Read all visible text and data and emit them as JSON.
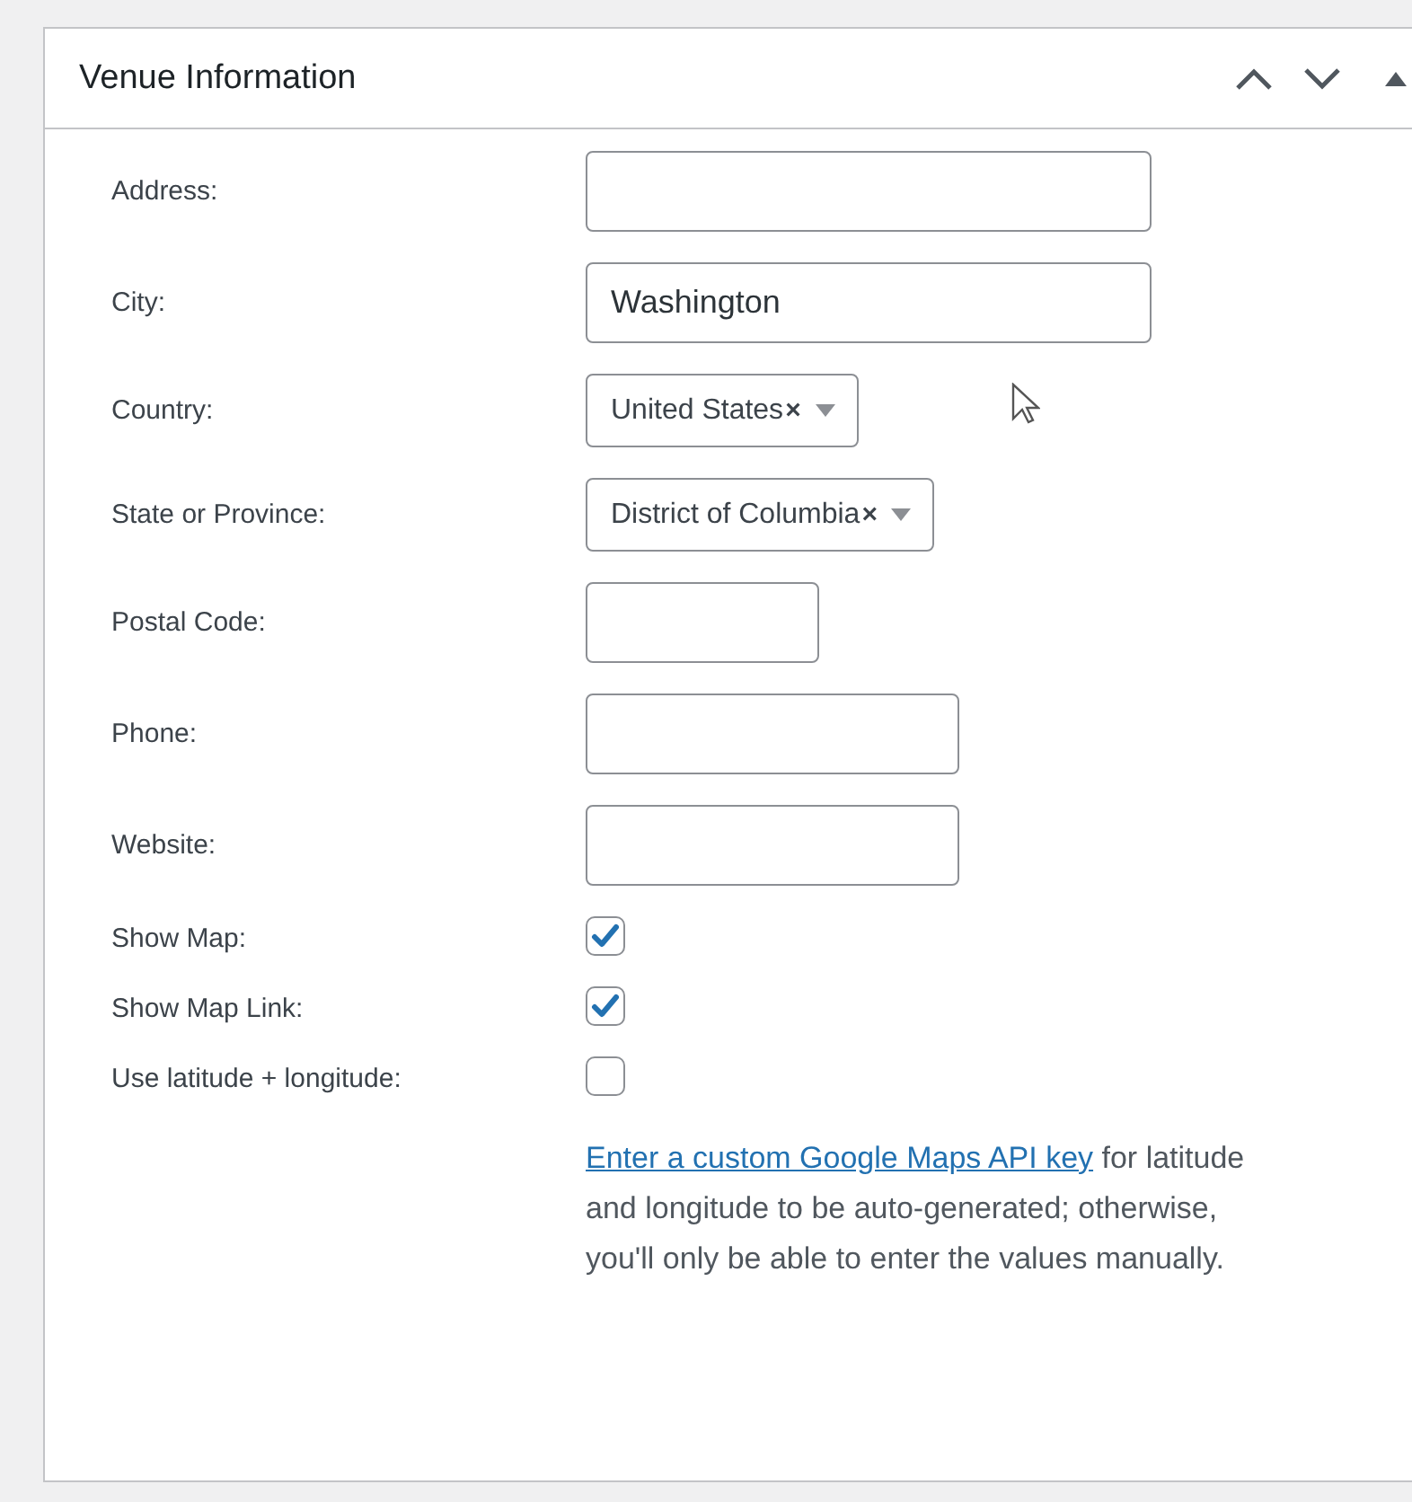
{
  "panel": {
    "title": "Venue Information"
  },
  "fields": [
    {
      "kind": "text",
      "label": "Address:"
    },
    {
      "kind": "text",
      "label": "City:",
      "value": "Washington"
    },
    {
      "kind": "select",
      "label": "Country:",
      "value": "United States",
      "clear": "×"
    },
    {
      "kind": "select",
      "label": "State or Province:",
      "value": "District of Columbia",
      "clear": "×"
    },
    {
      "kind": "text",
      "label": "Postal Code:"
    },
    {
      "kind": "text",
      "label": "Phone:"
    },
    {
      "kind": "text",
      "label": "Website:"
    },
    {
      "kind": "checkbox",
      "label": "Show Map:",
      "checked": true
    },
    {
      "kind": "checkbox",
      "label": "Show Map Link:",
      "checked": true
    },
    {
      "kind": "checkbox",
      "label": "Use latitude + longitude:",
      "checked": false
    }
  ],
  "help": {
    "link": "Enter a custom Google Maps API key",
    "text": " for latitude and longitude to be auto-generated; otherwise, you'll only be able to enter the values manually."
  }
}
